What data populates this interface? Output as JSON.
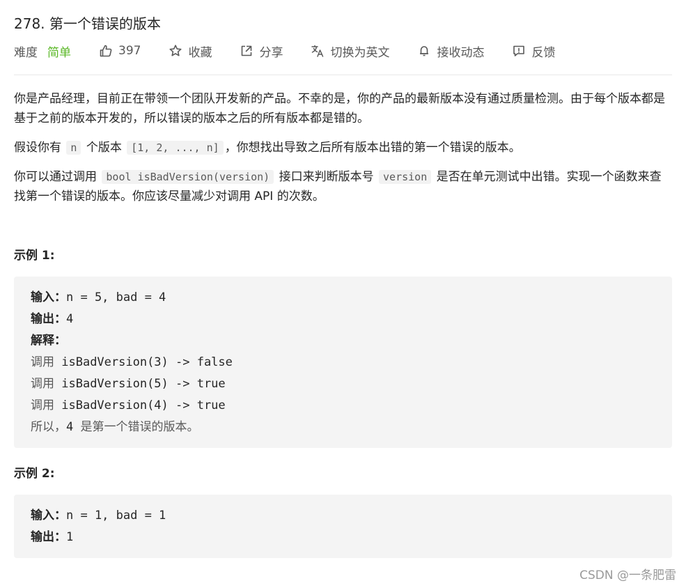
{
  "problem": {
    "title": "278. 第一个错误的版本",
    "difficulty_label": "难度",
    "difficulty_value": "简单",
    "likes": "397",
    "actions": {
      "collect": "收藏",
      "share": "分享",
      "switch_english": "切换为英文",
      "subscribe": "接收动态",
      "feedback": "反馈"
    }
  },
  "description": {
    "p1": "你是产品经理，目前正在带领一个团队开发新的产品。不幸的是，你的产品的最新版本没有通过质量检测。由于每个版本都是基于之前的版本开发的，所以错误的版本之后的所有版本都是错的。",
    "p2_before": "假设你有",
    "p2_code1": "n",
    "p2_mid": "个版本",
    "p2_code2": "[1, 2, ..., n]",
    "p2_after": "，你想找出导致之后所有版本出错的第一个错误的版本。",
    "p3_before": "你可以通过调用",
    "p3_code1": "bool isBadVersion(version)",
    "p3_mid": "接口来判断版本号",
    "p3_code2": "version",
    "p3_after": "是否在单元测试中出错。实现一个函数来查找第一个错误的版本。你应该尽量减少对调用 API 的次数。"
  },
  "example1": {
    "heading": "示例 1:",
    "input_label": "输入：",
    "input_value": "n = 5, bad = 4",
    "output_label": "输出：",
    "output_value": "4",
    "explain_label": "解释：",
    "calls": [
      {
        "prefix": "调用",
        "code": "isBadVersion(3) -> false"
      },
      {
        "prefix": "调用",
        "code": "isBadVersion(5) -> true"
      },
      {
        "prefix": "调用",
        "code": "isBadVersion(4) -> true"
      }
    ],
    "conclusion_prefix": "所以，",
    "conclusion_code": "4",
    "conclusion_suffix": "是第一个错误的版本。"
  },
  "example2": {
    "heading": "示例 2:",
    "input_label": "输入：",
    "input_value": "n = 1, bad = 1",
    "output_label": "输出：",
    "output_value": "1"
  },
  "watermark": "CSDN @一条肥雷"
}
